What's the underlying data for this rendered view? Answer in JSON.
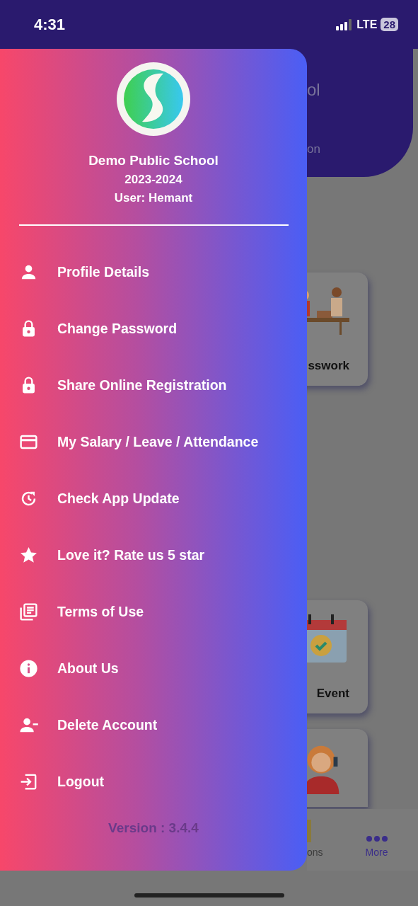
{
  "status_bar": {
    "time": "4:31",
    "network": "LTE",
    "battery": "28"
  },
  "background": {
    "header_title": "ol",
    "header_subtitle": "on",
    "cards": [
      {
        "kind": "picture",
        "label": "sswork"
      },
      {
        "kind": "picture",
        "label": "Event"
      },
      {
        "kind": "picture"
      }
    ],
    "bottom_nav": [
      {
        "label": "ons",
        "selected": false
      },
      {
        "label": "More",
        "selected": true
      }
    ]
  },
  "drawer": {
    "school": "Demo Public School",
    "year": "2023-2024",
    "user": "User: Hemant",
    "items": [
      {
        "kind": "person",
        "label": "Profile Details"
      },
      {
        "kind": "lock",
        "label": "Change Password"
      },
      {
        "kind": "lock",
        "label": "Share Online Registration"
      },
      {
        "kind": "card",
        "label": "My Salary / Leave / Attendance"
      },
      {
        "kind": "update",
        "label": "Check App Update"
      },
      {
        "kind": "star",
        "label": "Love it? Rate us 5 star"
      },
      {
        "kind": "docs",
        "label": "Terms of Use"
      },
      {
        "kind": "info",
        "label": "About Us"
      },
      {
        "kind": "person-remove",
        "label": "Delete Account"
      },
      {
        "kind": "logout",
        "label": "Logout"
      }
    ],
    "version": "Version : 3.4.4"
  }
}
